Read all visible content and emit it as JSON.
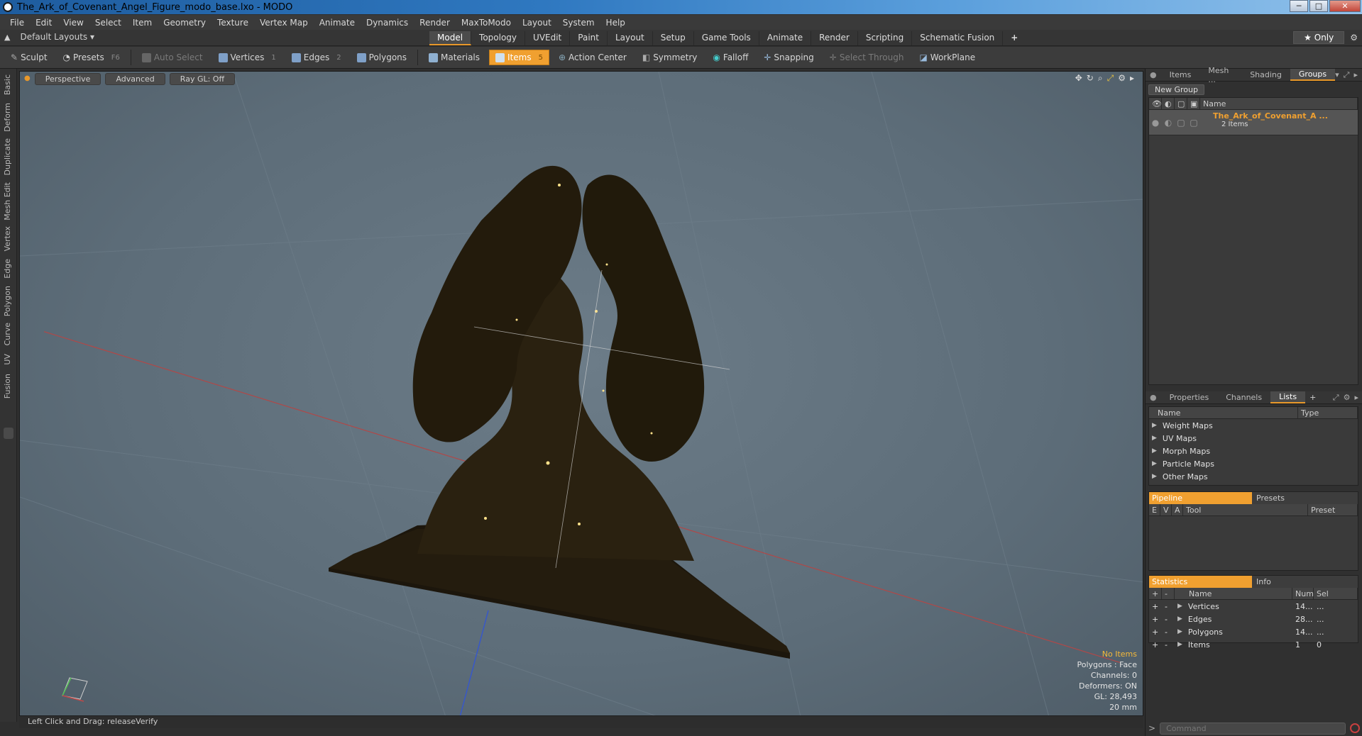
{
  "window": {
    "title": "The_Ark_of_Covenant_Angel_Figure_modo_base.lxo - MODO",
    "min": "─",
    "max": "□",
    "close": "✕"
  },
  "menu": [
    "File",
    "Edit",
    "View",
    "Select",
    "Item",
    "Geometry",
    "Texture",
    "Vertex Map",
    "Animate",
    "Dynamics",
    "Render",
    "MaxToModo",
    "Layout",
    "System",
    "Help"
  ],
  "layoutbar": {
    "layouts_label": "Default Layouts ▾",
    "tabs": [
      "Model",
      "Topology",
      "UVEdit",
      "Paint",
      "Layout",
      "Setup",
      "Game Tools",
      "Animate",
      "Render",
      "Scripting",
      "Schematic Fusion"
    ],
    "active_tab": "Model",
    "add": "+",
    "only_label": "★  Only",
    "gear": "⚙"
  },
  "toolbar": {
    "sculpt": "Sculpt",
    "presets": "Presets",
    "presets_key": "F6",
    "auto_select": "Auto Select",
    "vertices": "Vertices",
    "vertices_key": "1",
    "edges": "Edges",
    "edges_key": "2",
    "polygons": "Polygons",
    "materials": "Materials",
    "items": "Items",
    "items_key": "5",
    "action_center": "Action Center",
    "symmetry": "Symmetry",
    "falloff": "Falloff",
    "snapping": "Snapping",
    "select_through": "Select Through",
    "workplane": "WorkPlane"
  },
  "left_tabs": [
    "Basic",
    "Deform",
    "Duplicate",
    "Mesh Edit",
    "Vertex",
    "Edge",
    "Polygon",
    "Curve",
    "UV",
    "Fusion"
  ],
  "viewport": {
    "perspective": "Perspective",
    "advanced": "Advanced",
    "raygl": "Ray GL: Off",
    "info": {
      "items": "No Items",
      "polygons": "Polygons : Face",
      "channels": "Channels: 0",
      "deformers": "Deformers: ON",
      "gl": "GL: 28,493",
      "scale": "20 mm"
    }
  },
  "status": {
    "text": "Left Click and Drag:   releaseVerify"
  },
  "right": {
    "top_tabs": [
      "Items",
      "Mesh ...",
      "Shading",
      "Groups"
    ],
    "active_top_tab": "Groups",
    "new_group": "New Group",
    "groups_col_name": "Name",
    "group_name": "The_Ark_of_Covenant_A ...",
    "group_count": "2 Items",
    "mid_tabs": [
      "Properties",
      "Channels",
      "Lists"
    ],
    "active_mid_tab": "Lists",
    "lists_cols": [
      "Name",
      "Type"
    ],
    "lists": [
      "Weight Maps",
      "UV Maps",
      "Morph Maps",
      "Particle Maps",
      "Other Maps"
    ],
    "pipeline_tab": "Pipeline",
    "presets_tab": "Presets",
    "pipeline_cols": [
      "E",
      "V",
      "A",
      "Tool",
      "Preset"
    ],
    "stats_tab": "Statistics",
    "info_tab": "Info",
    "stats_cols": [
      "+",
      "-",
      "Name",
      "Num",
      "Sel"
    ],
    "stats": [
      {
        "name": "Vertices",
        "num": "14...",
        "sel": "..."
      },
      {
        "name": "Edges",
        "num": "28...",
        "sel": "..."
      },
      {
        "name": "Polygons",
        "num": "14...",
        "sel": "..."
      },
      {
        "name": "Items",
        "num": "1",
        "sel": "0"
      }
    ],
    "command_placeholder": "Command"
  },
  "colors": {
    "accent": "#f0a030",
    "viewport_bg": "#5d6d79",
    "statue": "#241c0e"
  }
}
